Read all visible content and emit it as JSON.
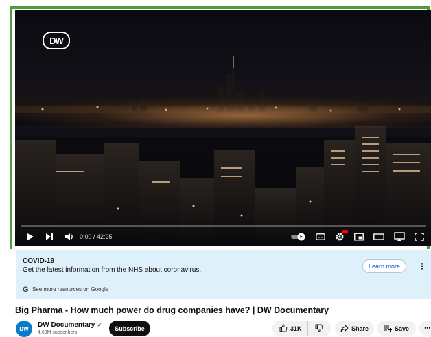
{
  "player": {
    "brand_logo_text": "DW",
    "time_display": "0:00 / 42:25",
    "progress_fraction": 0,
    "accent_color": "#ff0000"
  },
  "covid_panel": {
    "title": "COVID-19",
    "message": "Get the latest information from the NHS about coronavirus.",
    "learn_more_label": "Learn more",
    "more_resources_icon": "G",
    "more_resources_text": "See more resources on Google",
    "background_color": "#def1fb"
  },
  "video": {
    "title": "Big Pharma - How much power do drug companies have? | DW Documentary"
  },
  "channel": {
    "avatar_text": "DW",
    "name": "DW Documentary",
    "subscribers": "4.63M subscribers",
    "subscribe_label": "Subscribe"
  },
  "actions": {
    "like_count": "31K",
    "share_label": "Share",
    "save_label": "Save"
  }
}
